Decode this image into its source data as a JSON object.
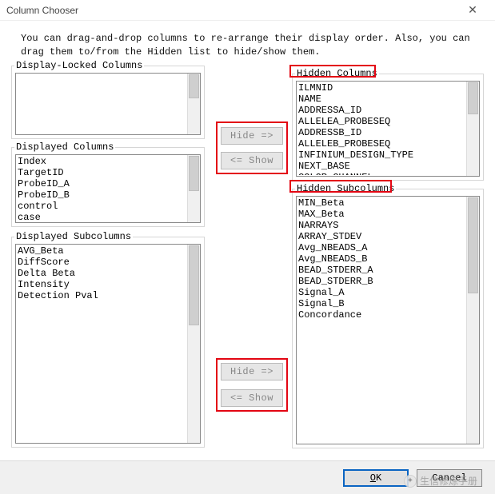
{
  "window": {
    "title": "Column Chooser",
    "close_glyph": "✕"
  },
  "intro": "You can drag-and-drop columns to re-arrange their display order.  Also, you can drag them to/from the Hidden list to hide/show them.",
  "groups": {
    "display_locked": {
      "label": "Display-Locked Columns"
    },
    "displayed_cols": {
      "label": "Displayed Columns"
    },
    "displayed_sub": {
      "label": "Displayed Subcolumns"
    },
    "hidden_cols": {
      "label": "Hidden Columns"
    },
    "hidden_sub": {
      "label": "Hidden Subcolumns"
    }
  },
  "buttons": {
    "hide": "Hide =>",
    "show": "<= Show",
    "ok_letter": "O",
    "ok_rest": "K",
    "cancel": "Cancel"
  },
  "lists": {
    "display_locked": [],
    "displayed_cols": [
      "Index",
      "TargetID",
      "ProbeID_A",
      "ProbeID_B",
      "control",
      "case"
    ],
    "displayed_sub": [
      "AVG_Beta",
      "DiffScore",
      "Delta Beta",
      "Intensity",
      "Detection Pval"
    ],
    "hidden_cols": [
      "ILMNID",
      "NAME",
      "ADDRESSA_ID",
      "ALLELEA_PROBESEQ",
      "ADDRESSB_ID",
      "ALLELEB_PROBESEQ",
      "INFINIUM_DESIGN_TYPE",
      "NEXT_BASE",
      "COLOR_CHANNEL"
    ],
    "hidden_sub": [
      "MIN_Beta",
      "MAX_Beta",
      "NARRAYS",
      "ARRAY_STDEV",
      "Avg_NBEADS_A",
      "Avg_NBEADS_B",
      "BEAD_STDERR_A",
      "BEAD_STDERR_B",
      "Signal_A",
      "Signal_B",
      "Concordance"
    ]
  },
  "watermark": "生信修炼手册"
}
